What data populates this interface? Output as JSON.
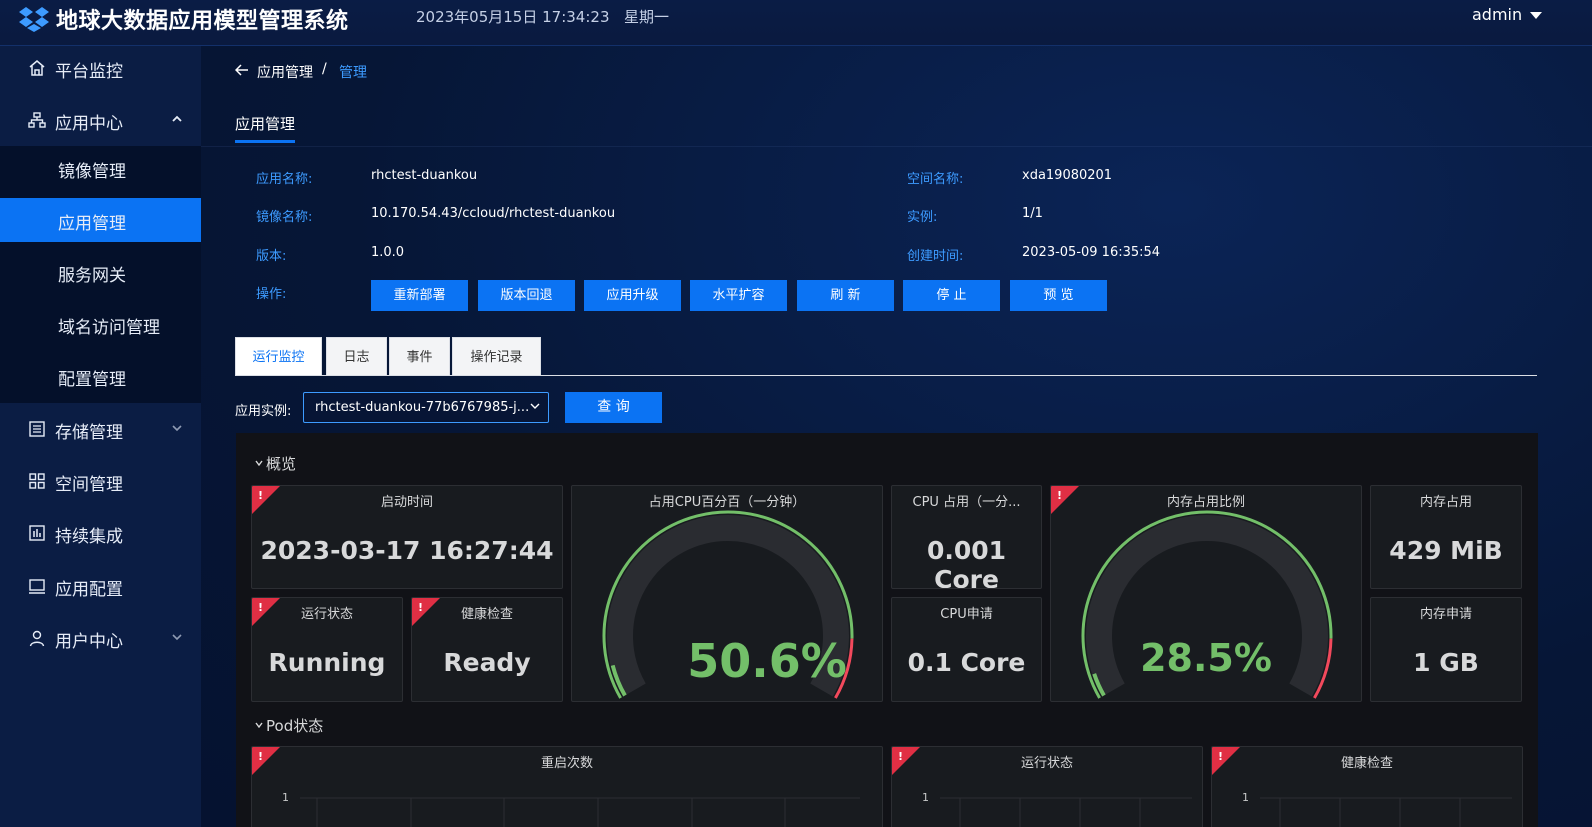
{
  "header": {
    "system_title": "地球大数据应用模型管理系统",
    "datetime": "2023年05月15日 17:34:23",
    "weekday": "星期一",
    "user": "admin"
  },
  "sidebar": {
    "items": [
      {
        "label": "平台监控",
        "icon": "home-icon"
      },
      {
        "label": "应用中心",
        "icon": "sitemap-icon"
      },
      {
        "label": "存储管理",
        "icon": "list-icon"
      },
      {
        "label": "空间管理",
        "icon": "grid-icon"
      },
      {
        "label": "持续集成",
        "icon": "chart-icon"
      },
      {
        "label": "应用配置",
        "icon": "monitor-icon"
      },
      {
        "label": "用户中心",
        "icon": "user-icon"
      }
    ],
    "sub_items": [
      {
        "label": "镜像管理"
      },
      {
        "label": "应用管理"
      },
      {
        "label": "服务网关"
      },
      {
        "label": "域名访问管理"
      },
      {
        "label": "配置管理"
      }
    ]
  },
  "breadcrumb": {
    "parent": "应用管理",
    "separator": "/",
    "current": "管理"
  },
  "page_tab": "应用管理",
  "info": {
    "app_name_label": "应用名称:",
    "app_name": "rhctest-duankou",
    "image_label": "镜像名称:",
    "image": "10.170.54.43/ccloud/rhctest-duankou",
    "version_label": "版本:",
    "version": "1.0.0",
    "ops_label": "操作:",
    "space_label": "空间名称:",
    "space": "xda19080201",
    "instance_label": "实例:",
    "instance": "1/1",
    "created_label": "创建时间:",
    "created": "2023-05-09 16:35:54"
  },
  "ops": [
    "重新部署",
    "版本回退",
    "应用升级",
    "水平扩容",
    "刷 新",
    "停 止",
    "预 览"
  ],
  "inner_tabs": [
    "运行监控",
    "日志",
    "事件",
    "操作记录"
  ],
  "instance_select": {
    "label": "应用实例:",
    "value": "rhctest-duankou-77b6767985-j...",
    "query": "查 询"
  },
  "dashboard": {
    "overview_title": "概览",
    "pod_title": "Pod状态",
    "start_time": {
      "title": "启动时间",
      "value": "2023-03-17 16:27:44"
    },
    "cpu_gauge": {
      "title": "占用CPU百分百（一分钟）",
      "value": "50.6%",
      "percent": 50.6
    },
    "cpu_usage": {
      "title": "CPU 占用（一分...",
      "value": "0.001 Core"
    },
    "mem_gauge": {
      "title": "内存占用比例",
      "value": "28.5%",
      "percent": 28.5
    },
    "mem_usage": {
      "title": "内存占用",
      "value": "429 MiB"
    },
    "run_state": {
      "title": "运行状态",
      "value": "Running"
    },
    "health": {
      "title": "健康检查",
      "value": "Ready"
    },
    "cpu_request": {
      "title": "CPU申请",
      "value": "0.1 Core"
    },
    "mem_request": {
      "title": "内存申请",
      "value": "1 GB"
    },
    "restart": {
      "title": "重启次数",
      "axis": "1"
    },
    "pod_run": {
      "title": "运行状态",
      "axis": "1"
    },
    "pod_health": {
      "title": "健康检查",
      "axis": "1"
    }
  },
  "colors": {
    "accent": "#0b73f3",
    "link": "#3d9bff",
    "gauge_green": "#73bf69",
    "gauge_red": "#f2495c",
    "warn": "#e02f44"
  }
}
